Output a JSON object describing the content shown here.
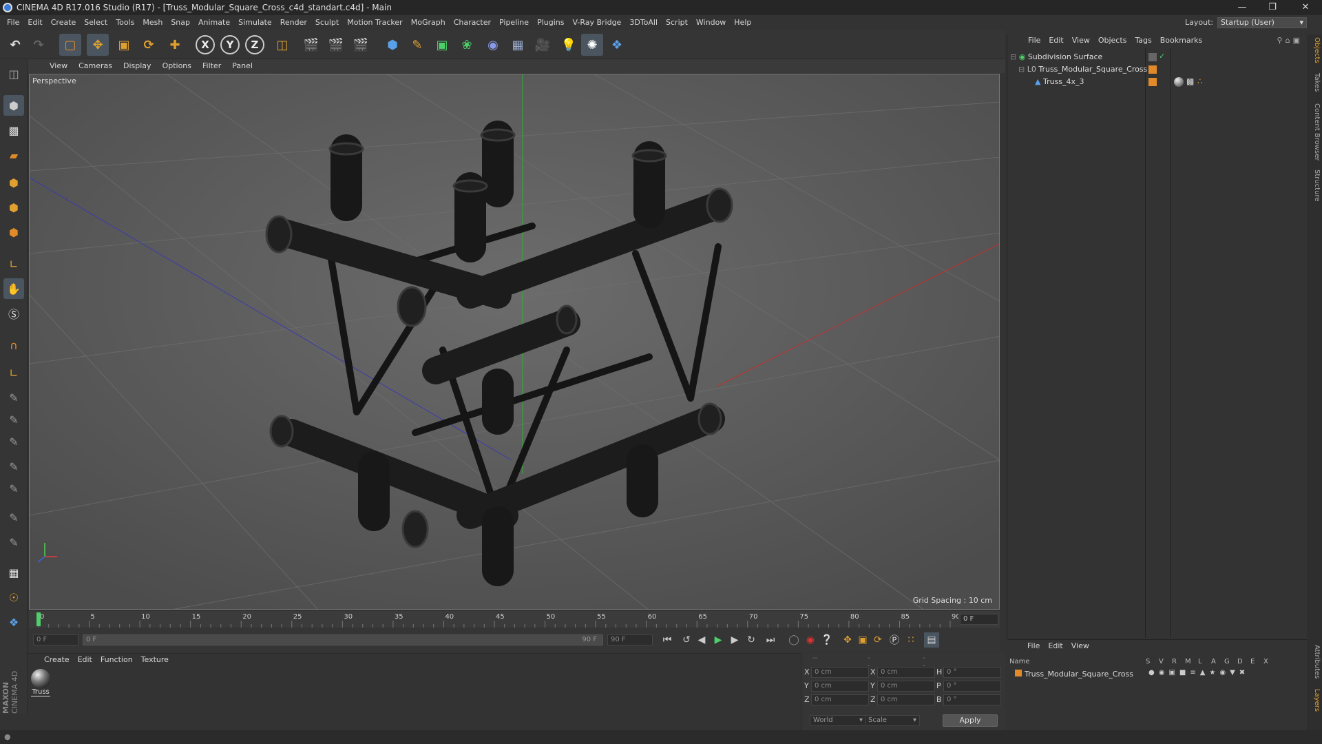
{
  "app": {
    "title": "CINEMA 4D R17.016 Studio (R17) - [Truss_Modular_Square_Cross_c4d_standart.c4d] - Main",
    "window_controls": [
      "—",
      "❐",
      "✕"
    ]
  },
  "menubar": {
    "items": [
      "File",
      "Edit",
      "Create",
      "Select",
      "Tools",
      "Mesh",
      "Snap",
      "Animate",
      "Simulate",
      "Render",
      "Sculpt",
      "Motion Tracker",
      "MoGraph",
      "Character",
      "Pipeline",
      "Plugins",
      "V-Ray Bridge",
      "3DToAll",
      "Script",
      "Window",
      "Help"
    ],
    "layout_label": "Layout:",
    "layout_value": "Startup (User)"
  },
  "toolbar": {
    "axis_x": "X",
    "axis_y": "Y",
    "axis_z": "Z"
  },
  "viewport": {
    "menu": [
      "View",
      "Cameras",
      "Display",
      "Options",
      "Filter",
      "Panel"
    ],
    "label": "Perspective",
    "grid_spacing": "Grid Spacing : 10 cm"
  },
  "timeline": {
    "ticks": [
      "0",
      "5",
      "10",
      "15",
      "20",
      "25",
      "30",
      "35",
      "40",
      "45",
      "50",
      "55",
      "60",
      "65",
      "70",
      "75",
      "80",
      "85",
      "90"
    ],
    "current_frame": "0 F"
  },
  "transport": {
    "start_field": "0 F",
    "range_start": "0 F",
    "range_end": "90 F",
    "end_field": "90 F"
  },
  "materials": {
    "menu": [
      "Create",
      "Edit",
      "Function",
      "Texture"
    ],
    "items": [
      {
        "name": "Truss"
      }
    ]
  },
  "coordinates": {
    "header": [
      "--",
      "--",
      "--"
    ],
    "rows": [
      {
        "l1": "X",
        "v1": "0 cm",
        "l2": "X",
        "v2": "0 cm",
        "l3": "H",
        "v3": "0 °"
      },
      {
        "l1": "Y",
        "v1": "0 cm",
        "l2": "Y",
        "v2": "0 cm",
        "l3": "P",
        "v3": "0 °"
      },
      {
        "l1": "Z",
        "v1": "0 cm",
        "l2": "Z",
        "v2": "0 cm",
        "l3": "B",
        "v3": "0 °"
      }
    ],
    "mode1": "World",
    "mode2": "Scale",
    "apply": "Apply"
  },
  "object_manager": {
    "menu": [
      "File",
      "Edit",
      "View",
      "Objects",
      "Tags",
      "Bookmarks"
    ],
    "objects": [
      {
        "name": "Subdivision Surface"
      },
      {
        "name": "Truss_Modular_Square_Cross"
      },
      {
        "name": "Truss_4x_3"
      }
    ]
  },
  "attribute_manager": {
    "menu": [
      "File",
      "Edit",
      "View"
    ],
    "columns": [
      "Name",
      "S",
      "V",
      "R",
      "M",
      "L",
      "A",
      "G",
      "D",
      "E",
      "X"
    ],
    "row": "Truss_Modular_Square_Cross"
  },
  "right_tabs": [
    "Objects",
    "Takes",
    "Content Browser",
    "Structure",
    "Attributes",
    "Layers"
  ],
  "brand": {
    "maxon": "MAXON",
    "cinema": "CINEMA 4D"
  },
  "colors": {
    "accent": "#3b7bd6",
    "orange": "#e08a2a",
    "active_tab": "#4a5560"
  }
}
